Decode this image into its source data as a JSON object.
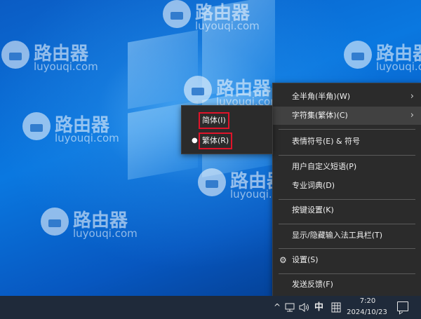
{
  "watermark": {
    "title": "路由器",
    "subtitle": "luyouqi.com"
  },
  "context_menu": {
    "items": [
      {
        "label": "全半角(半角)(W)",
        "has_submenu": true
      },
      {
        "label": "字符集(繁体)(C)",
        "has_submenu": true
      },
      {
        "label": "表情符号(E) & 符号",
        "has_submenu": false
      },
      {
        "label": "用户自定义短语(P)",
        "has_submenu": false
      },
      {
        "label": "专业词典(D)",
        "has_submenu": false
      },
      {
        "label": "按键设置(K)",
        "has_submenu": false
      },
      {
        "label": "显示/隐藏输入法工具栏(T)",
        "has_submenu": false
      },
      {
        "label": "设置(S)",
        "has_submenu": false
      },
      {
        "label": "发送反馈(F)",
        "has_submenu": false
      }
    ],
    "submenu_arrow": "›",
    "settings_icon": "gear-icon",
    "gear_glyph": "⚙"
  },
  "charset_submenu": {
    "items": [
      {
        "label": "简体(I)",
        "selected": false
      },
      {
        "label": "繁体(R)",
        "selected": true
      }
    ],
    "selected_marker": "●",
    "highlight_color": "#e0142a"
  },
  "taskbar": {
    "chevron": "^",
    "ime_mode": "中",
    "time": "7:20",
    "date": "2024/10/23",
    "tray_icons": [
      "chevron-up-icon",
      "network-icon",
      "volume-icon",
      "ime-mode-indicator",
      "ime-keyboard-icon",
      "notification-icon"
    ]
  }
}
